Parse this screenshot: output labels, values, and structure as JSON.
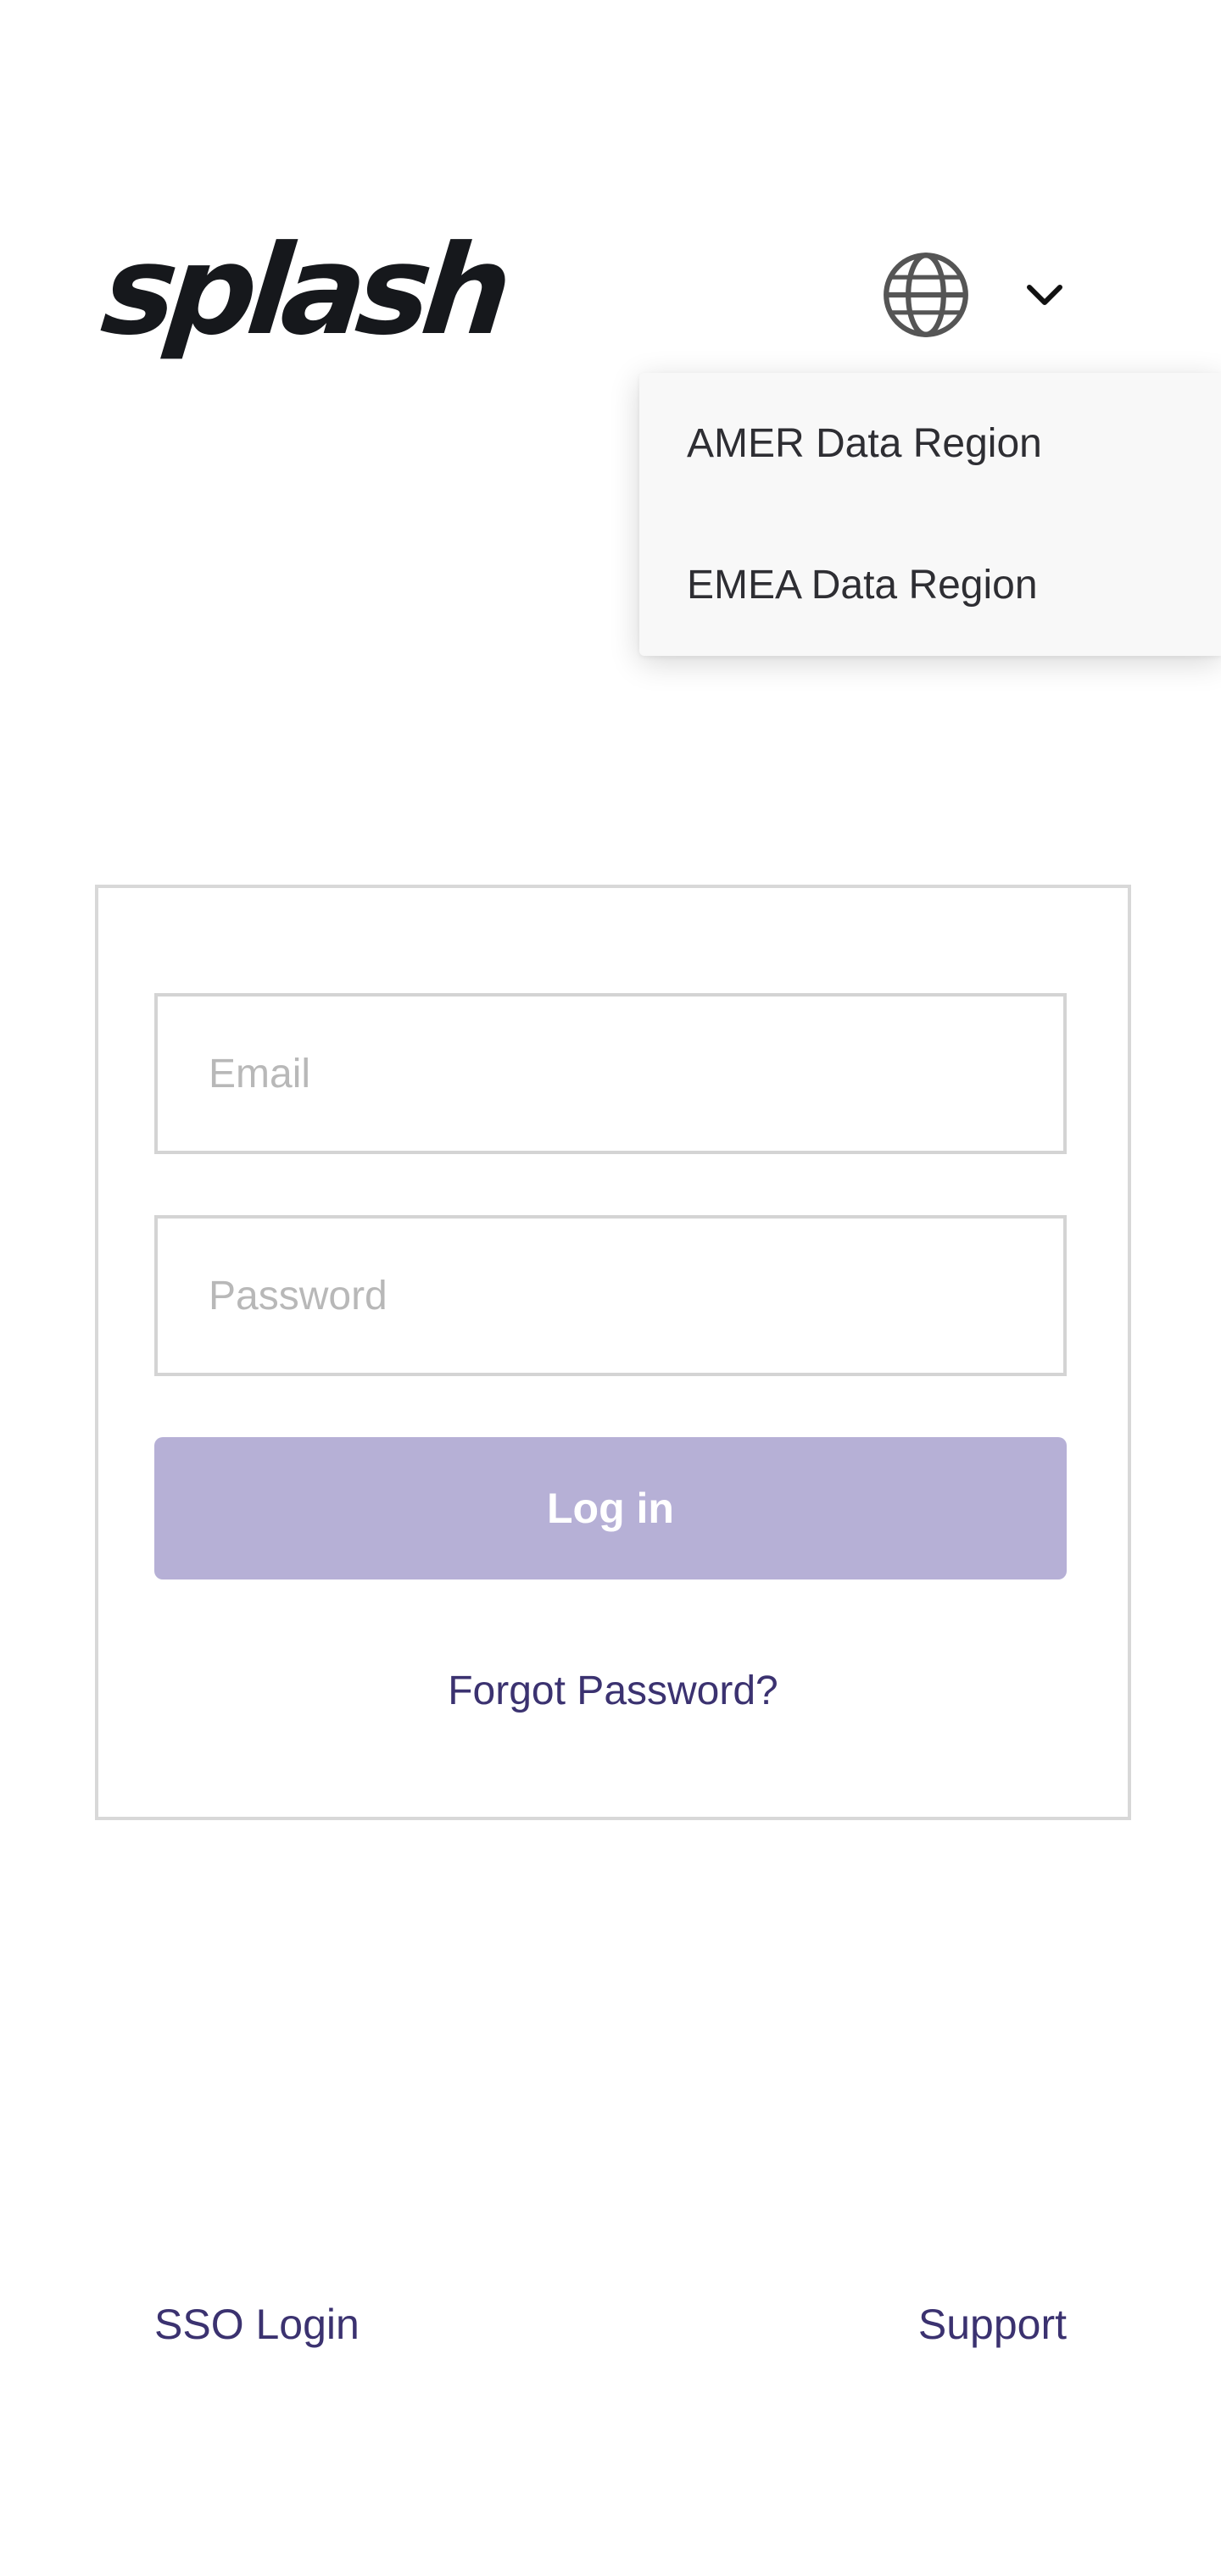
{
  "header": {
    "logo_text": "splash",
    "region_selector": {
      "icon": "globe-icon",
      "chevron": "chevron-down-icon"
    }
  },
  "region_dropdown": {
    "items": [
      {
        "label": "AMER Data Region"
      },
      {
        "label": "EMEA Data Region"
      }
    ]
  },
  "login_form": {
    "email": {
      "value": "",
      "placeholder": "Email"
    },
    "password": {
      "value": "",
      "placeholder": "Password"
    },
    "submit_label": "Log in",
    "forgot_label": "Forgot Password?"
  },
  "footer": {
    "sso_label": "SSO Login",
    "support_label": "Support"
  },
  "colors": {
    "accent": "#3b3270",
    "button_disabled": "#b6b0d6",
    "logo": "#16181c"
  }
}
